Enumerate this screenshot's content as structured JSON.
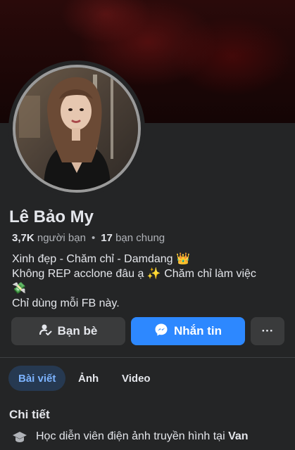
{
  "profile": {
    "name": "Lê Bảo My",
    "friends_count": "3,7K",
    "friends_label": "người bạn",
    "mutual_count": "17",
    "mutual_label": "bạn chung",
    "bio": [
      "Xinh đẹp - Chăm chỉ - Damdang 👑",
      "Không REP acclone đâu ạ ✨ Chăm chỉ làm việc",
      "💸",
      "Chỉ dùng mỗi FB này."
    ]
  },
  "actions": {
    "friends_label": "Bạn bè",
    "message_label": "Nhắn tin",
    "more_label": "···"
  },
  "tabs": [
    "Bài viết",
    "Ảnh",
    "Video"
  ],
  "details": {
    "title": "Chi tiết",
    "education_prefix": "Học diễn viên điện ảnh truyền hình tại",
    "education_school": "Van"
  },
  "colors": {
    "accent": "#2d88ff",
    "background": "#242526",
    "button": "#3a3b3c"
  }
}
